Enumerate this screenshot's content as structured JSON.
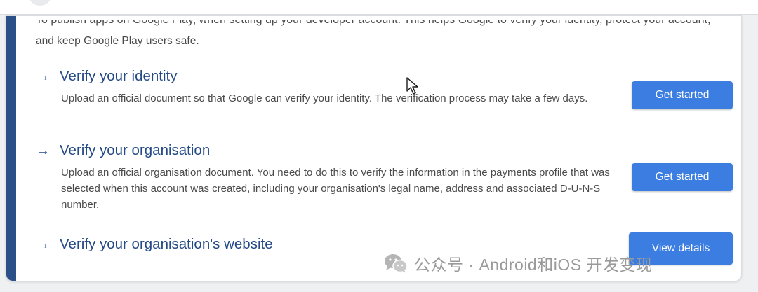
{
  "intro": {
    "partial_line": "To publish apps on Google Play, when setting up your developer account. This helps Google to verify your identity, protect your account,",
    "line": "and keep Google Play users safe."
  },
  "sections": [
    {
      "title": "Verify your identity",
      "description": "Upload an official document so that Google can verify your identity. The verification process may take a few days.",
      "button": "Get started"
    },
    {
      "title": "Verify your organisation",
      "description": "Upload an official organisation document. You need to do this to verify the information in the payments profile that was selected when this account was created, including your organisation's legal name, address and associated D-U-N-S number.",
      "button": "Get started"
    },
    {
      "title": "Verify your organisation's website",
      "description": "",
      "button": "View details"
    }
  ],
  "watermark": {
    "text": "公众号 · Android和iOS 开发变现"
  },
  "icons": {
    "section_arrow": "arrow-right-icon",
    "cursor": "mouse-pointer-icon",
    "watermark": "wechat-icon"
  },
  "colors": {
    "accent_bar": "#2b5088",
    "title": "#234a86",
    "button": "#3b7de0",
    "button_text": "#ffffff",
    "body_text": "#4a4a4a"
  }
}
